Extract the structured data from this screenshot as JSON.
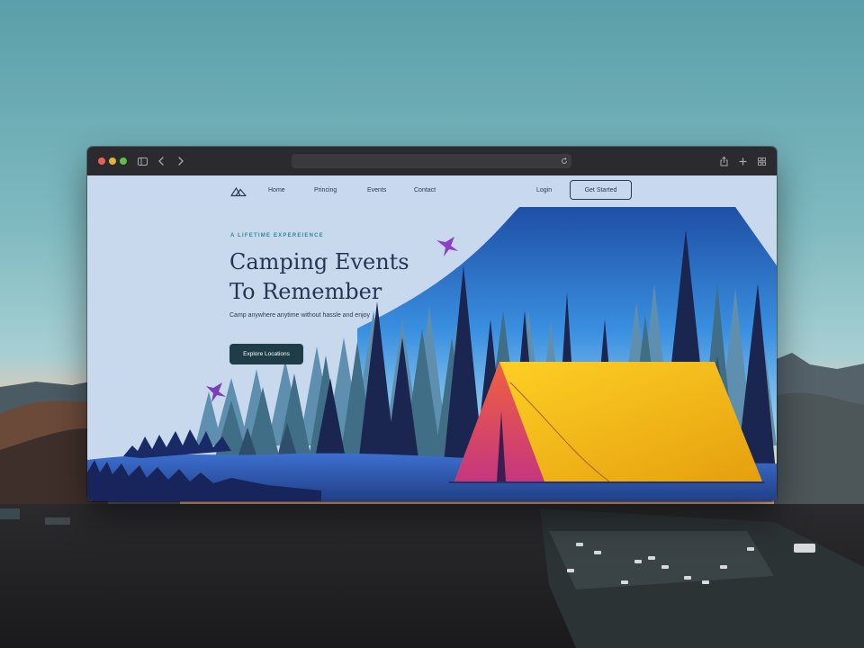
{
  "browser": {
    "address_value": "",
    "icons": [
      "sidebar-icon",
      "back-icon",
      "forward-icon",
      "reload-icon",
      "share-icon",
      "new-tab-icon",
      "tab-overview-icon"
    ]
  },
  "nav": {
    "logo_icon": "mountain-logo-icon",
    "links": [
      "Home",
      "Princing",
      "Events",
      "Contact"
    ],
    "login": "Login",
    "cta": "Get Started"
  },
  "hero": {
    "eyebrow": "A LIFETIME EXPEREIENCE",
    "title_line1": "Camping Events",
    "title_line2": "To Remember",
    "subtitle": "Camp anywhere anytime without hassle and enjoy",
    "cta": "Explore Locations"
  },
  "colors": {
    "accent": "#2f8a8f",
    "primary_dark": "#1f3d48",
    "text": "#273552",
    "site_bg": "#c8d9ee",
    "tent_yellow": "#f4c21a",
    "tent_red": "#d9456c"
  }
}
